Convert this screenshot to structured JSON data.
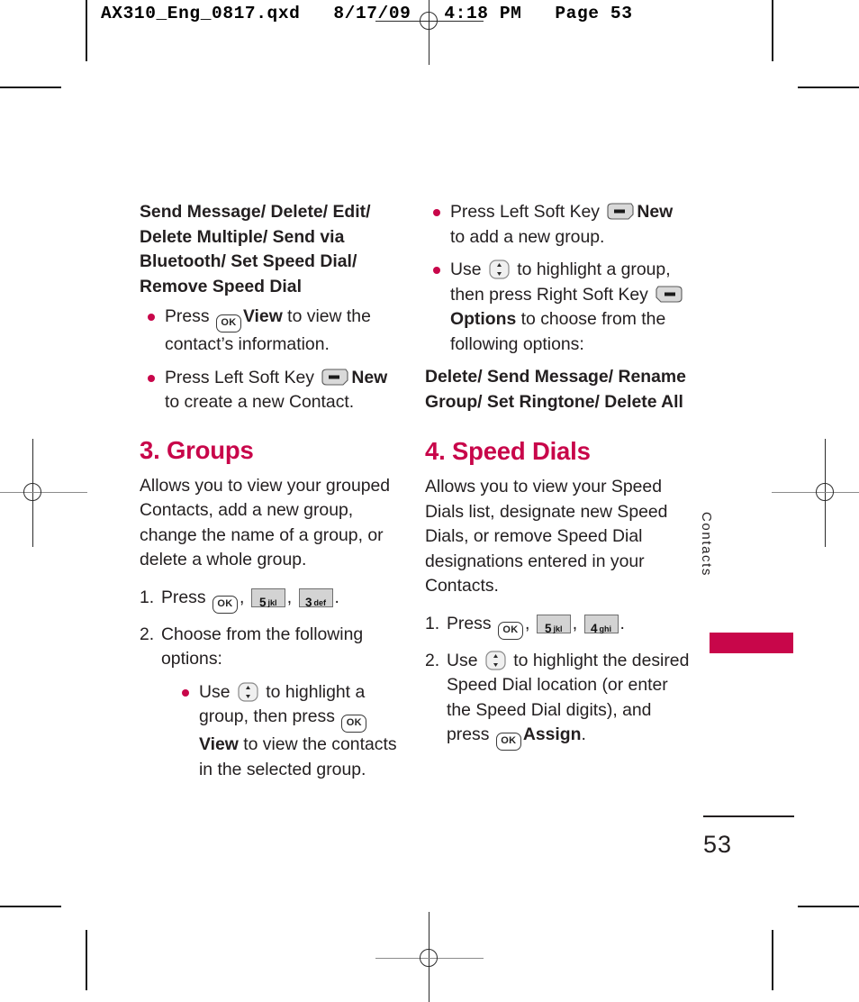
{
  "print_header": {
    "text": "AX310_Eng_0817.qxd   8/17/09   4:18 PM   Page 53"
  },
  "colors": {
    "accent": "#c8064a",
    "body_text": "#231f20",
    "key_fill": "#d3d3d3"
  },
  "left_column": {
    "options_list": {
      "text": "Send Message/ Delete/ Edit/ Delete Multiple/ Send via Bluetooth/ Set Speed Dial/ Remove Speed Dial"
    },
    "bullets": [
      {
        "seg1": "Press ",
        "key": "OK",
        "bold": "View",
        "seg2": " to view the contact’s information."
      },
      {
        "seg1": "Press Left Soft Key ",
        "key": "left-soft-key",
        "bold": "New",
        "seg2": " to create a new Contact."
      }
    ],
    "section": {
      "heading": "3. Groups",
      "intro": "Allows you to view your grouped Contacts, add a new group, change the name of a group, or delete a whole group.",
      "steps": [
        {
          "num": "1.",
          "seg1": "Press ",
          "keys": [
            "OK",
            "5 jkl",
            "3 def"
          ],
          "seg2": "."
        },
        {
          "num": "2.",
          "seg1": "Choose from the following options:",
          "subbullets": [
            {
              "seg1": "Use ",
              "nav_key": "up-down-nav-key",
              "seg2": " to highlight a group, then press ",
              "ok_key": "OK",
              "bold": "View",
              "seg3": " to view the contacts in the selected group."
            }
          ]
        }
      ]
    }
  },
  "right_column": {
    "bullets": [
      {
        "seg1": "Press Left Soft Key ",
        "key": "left-soft-key",
        "bold": "New",
        "seg2": " to add a new group."
      },
      {
        "seg1": "Use ",
        "nav_key": "up-down-nav-key",
        "seg2": " to highlight a group, then press Right Soft Key ",
        "soft_key": "right-soft-key",
        "bold": "Options",
        "seg3": " to choose from the following options:"
      }
    ],
    "options_list": {
      "text": "Delete/ Send Message/ Rename Group/ Set Ringtone/ Delete All"
    },
    "section": {
      "heading": "4. Speed Dials",
      "intro": "Allows you to view your Speed Dials list, designate new Speed Dials, or remove Speed Dial designations entered in your Contacts.",
      "steps": [
        {
          "num": "1.",
          "seg1": "Press ",
          "keys": [
            "OK",
            "5 jkl",
            "4 ghi"
          ],
          "seg2": "."
        },
        {
          "num": "2.",
          "seg1": "Use ",
          "nav_key": "up-down-nav-key",
          "seg2": " to highlight the desired Speed Dial location (or enter the Speed Dial digits), and press ",
          "ok_key": "OK",
          "bold": "Assign",
          "seg3": "."
        }
      ]
    }
  },
  "keys": {
    "ok_label": "OK",
    "k5": {
      "digit": "5",
      "letters": "jkl"
    },
    "k3": {
      "digit": "3",
      "letters": "def"
    },
    "k4": {
      "digit": "4",
      "letters": "ghi"
    }
  },
  "side_tab": {
    "label": "Contacts"
  },
  "folio": {
    "page_number": "53"
  }
}
